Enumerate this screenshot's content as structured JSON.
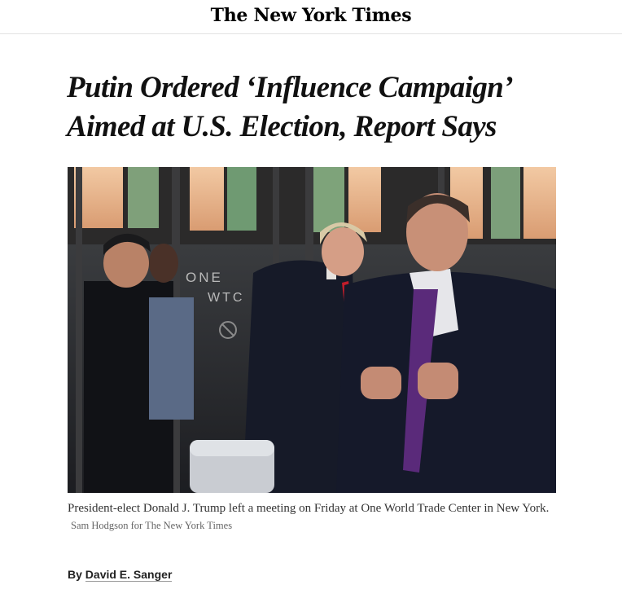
{
  "masthead": {
    "logo_text": "The New York Times"
  },
  "article": {
    "headline": "Putin Ordered ‘Influence Campaign’ Aimed at U.S. Election, Report Says",
    "photo": {
      "sign_line1": "ONE",
      "sign_line2": "WTC"
    },
    "caption": "President-elect Donald J. Trump left a meeting on Friday at One World Trade Center in New York.",
    "credit": "Sam Hodgson for The New York Times",
    "byline_prefix": "By",
    "author": "David E. Sanger"
  },
  "colors": {
    "text": "#121212",
    "divider": "#e2e2e2",
    "caption": "#333333",
    "credit": "#666666"
  }
}
